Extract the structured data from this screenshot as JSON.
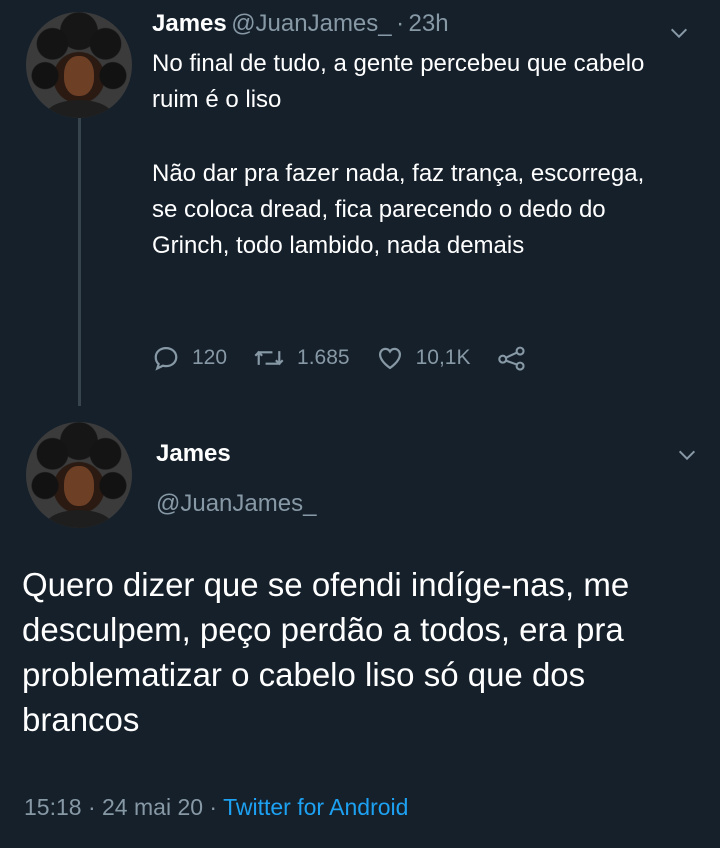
{
  "reply_tweet": {
    "author_name": "James",
    "author_handle": "@JuanJames_",
    "separator": "·",
    "time_ago": "23h",
    "text_paragraph_1": "No final de tudo, a gente percebeu que cabelo ruim é o liso",
    "text_paragraph_2": "Não dar pra fazer nada, faz trança, escorrega, se coloca dread, fica parecendo o dedo do Grinch, todo lambido, nada demais",
    "replies": "120",
    "retweets": "1.685",
    "likes": "10,1K"
  },
  "main_tweet": {
    "author_name": "James",
    "author_handle": "@JuanJames_",
    "text": "Quero dizer que se ofendi indíge-nas, me desculpem, peço perdão a todos, era pra problematizar o cabelo liso só que dos brancos",
    "time": "15:18",
    "separator": "·",
    "date": "24 mai 20",
    "source": "Twitter for Android"
  },
  "icons": {
    "reply": "reply-icon",
    "retweet": "retweet-icon",
    "like": "heart-icon",
    "share": "share-icon",
    "menu": "chevron-down-icon"
  },
  "colors": {
    "background": "#15202b",
    "primary_text": "#ffffff",
    "secondary_text": "#8899a6",
    "link": "#1da1f2"
  }
}
